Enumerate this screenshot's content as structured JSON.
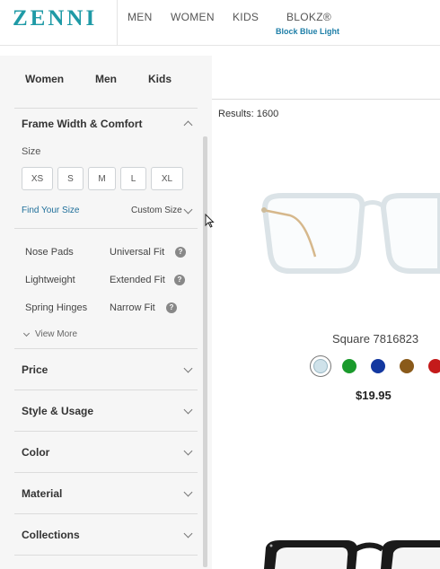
{
  "header": {
    "logo": "ZENNI",
    "nav": [
      "MEN",
      "WOMEN",
      "KIDS",
      "BLOKZ®"
    ],
    "blokz_sub": "Block Blue Light"
  },
  "sidebar": {
    "gender_tabs": [
      "Women",
      "Men",
      "Kids"
    ],
    "frame_width_title": "Frame Width & Comfort",
    "size_label": "Size",
    "sizes": [
      "XS",
      "S",
      "M",
      "L",
      "XL"
    ],
    "find_your_size": "Find Your Size",
    "custom_size": "Custom Size",
    "comfort_left": [
      "Nose Pads",
      "Lightweight",
      "Spring Hinges"
    ],
    "comfort_right": [
      "Universal Fit",
      "Extended Fit",
      "Narrow Fit"
    ],
    "view_more": "View More",
    "sections": [
      "Price",
      "Style & Usage",
      "Color",
      "Material",
      "Collections"
    ]
  },
  "results": {
    "label": "Results: 1600",
    "product_name": "Square 7816823",
    "price": "$19.95",
    "swatches": [
      "#cfe2ea",
      "#1a9a2c",
      "#1338a0",
      "#8a5a1a",
      "#c41a1a"
    ]
  }
}
